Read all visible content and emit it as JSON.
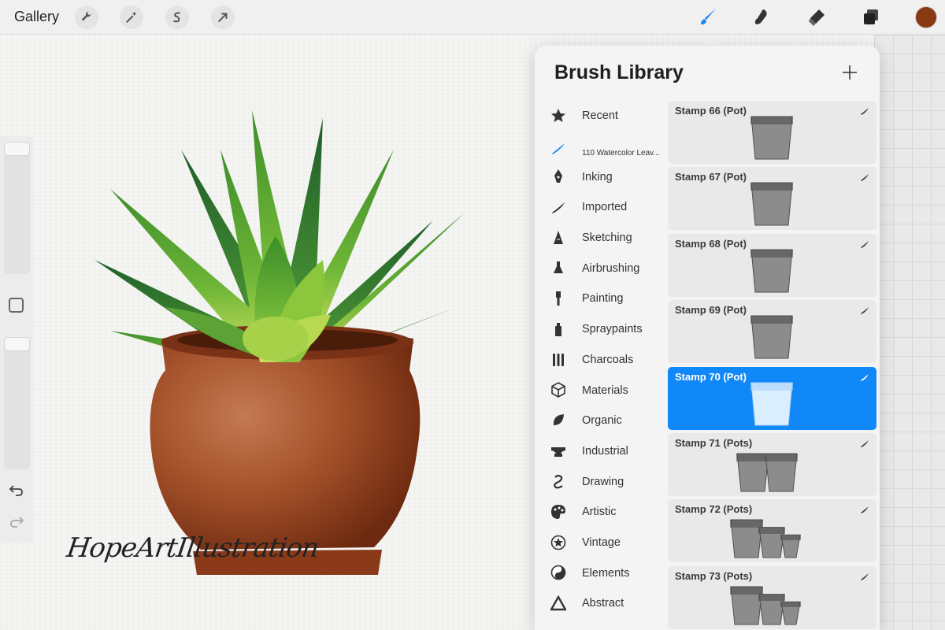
{
  "toolbar": {
    "gallery_label": "Gallery",
    "left_tools": [
      "wrench-icon",
      "magic-wand-icon",
      "selection-s-icon",
      "transform-arrow-icon"
    ],
    "right_tools": [
      "brush-icon",
      "smudge-icon",
      "eraser-icon",
      "layers-icon"
    ],
    "active_tool": "brush-icon",
    "active_color": "#8a3a12",
    "accent": "#1a87f5"
  },
  "sidebar": {
    "brush_size_level": 0.0,
    "opacity_level": 0.0,
    "tools": [
      "modify-square-icon",
      "undo-icon",
      "redo-icon"
    ]
  },
  "artwork": {
    "signature": "HopeArtIllustration"
  },
  "brush_library": {
    "title": "Brush Library",
    "add_icon": "plus-icon",
    "sets": [
      {
        "label": "Recent",
        "icon": "star-icon"
      },
      {
        "label": "110 Watercolor Leav...",
        "icon": "blue-stroke-icon",
        "selected": true
      },
      {
        "label": "Inking",
        "icon": "pen-nib-icon"
      },
      {
        "label": "Imported",
        "icon": "stroke-icon"
      },
      {
        "label": "Sketching",
        "icon": "pencil-tip-icon"
      },
      {
        "label": "Airbrushing",
        "icon": "airbrush-icon"
      },
      {
        "label": "Painting",
        "icon": "paintbrush-icon"
      },
      {
        "label": "Spraypaints",
        "icon": "spray-can-icon"
      },
      {
        "label": "Charcoals",
        "icon": "charcoal-sticks-icon"
      },
      {
        "label": "Materials",
        "icon": "cube-icon"
      },
      {
        "label": "Organic",
        "icon": "leaf-icon"
      },
      {
        "label": "Industrial",
        "icon": "anvil-icon"
      },
      {
        "label": "Drawing",
        "icon": "squiggle-icon"
      },
      {
        "label": "Artistic",
        "icon": "palette-icon"
      },
      {
        "label": "Vintage",
        "icon": "star-circle-icon"
      },
      {
        "label": "Elements",
        "icon": "yin-yang-icon"
      },
      {
        "label": "Abstract",
        "icon": "triangle-icon"
      }
    ],
    "brushes": [
      {
        "name": "Stamp 66 (Pot)",
        "pots": 1
      },
      {
        "name": "Stamp 67 (Pot)",
        "pots": 1
      },
      {
        "name": "Stamp 68 (Pot)",
        "pots": 1
      },
      {
        "name": "Stamp 69 (Pot)",
        "pots": 1
      },
      {
        "name": "Stamp 70 (Pot)",
        "pots": 1,
        "selected": true
      },
      {
        "name": "Stamp 71 (Pots)",
        "pots": 2
      },
      {
        "name": "Stamp 72 (Pots)",
        "pots": 3
      },
      {
        "name": "Stamp 73 (Pots)",
        "pots": 3
      }
    ]
  }
}
